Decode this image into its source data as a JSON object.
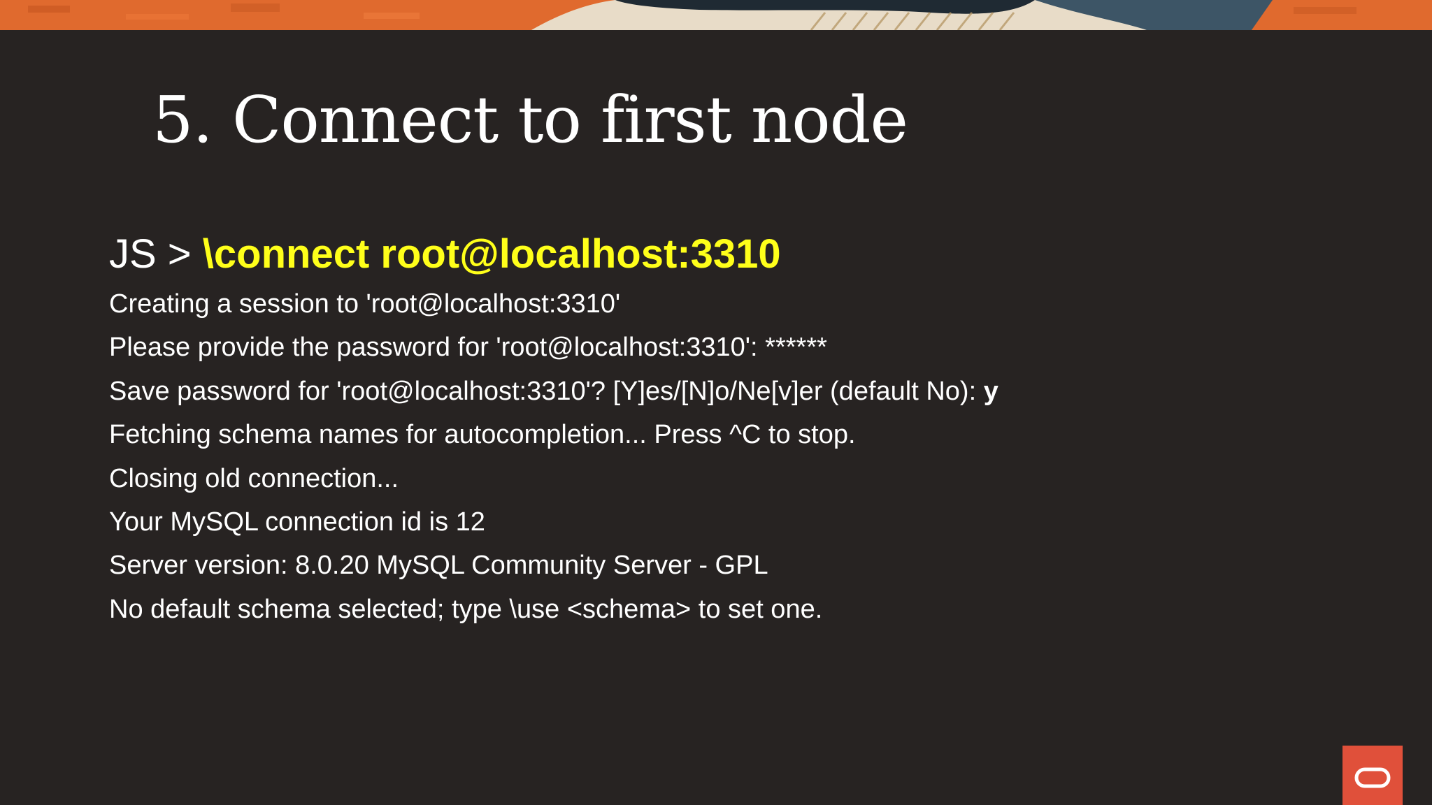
{
  "slide": {
    "title": "5. Connect to first node",
    "command_prompt": "JS > ",
    "command_text": "\\connect root@localhost:3310",
    "output_lines": [
      {
        "text": "Creating a session to 'root@localhost:3310'",
        "answer": ""
      },
      {
        "text": "Please provide the password for 'root@localhost:3310': ******",
        "answer": ""
      },
      {
        "text": "Save password for 'root@localhost:3310'? [Y]es/[N]o/Ne[v]er (default No): ",
        "answer": "y"
      },
      {
        "text": "Fetching schema names for autocompletion... Press ^C to stop.",
        "answer": ""
      },
      {
        "text": "Closing old connection...",
        "answer": ""
      },
      {
        "text": "Your MySQL connection id is 12",
        "answer": ""
      },
      {
        "text": "Server version: 8.0.20 MySQL Community Server - GPL",
        "answer": ""
      },
      {
        "text": "No default schema selected; type \\use <schema> to set one.",
        "answer": ""
      }
    ]
  },
  "colors": {
    "background": "#272322",
    "title_text": "#ffffff",
    "command_highlight": "#ffff1a",
    "banner_orange": "#e06a2e",
    "logo_box": "#e0503a"
  },
  "icons": {
    "banner": "decorative-artwork-banner",
    "logo": "oracle-logo-icon"
  }
}
